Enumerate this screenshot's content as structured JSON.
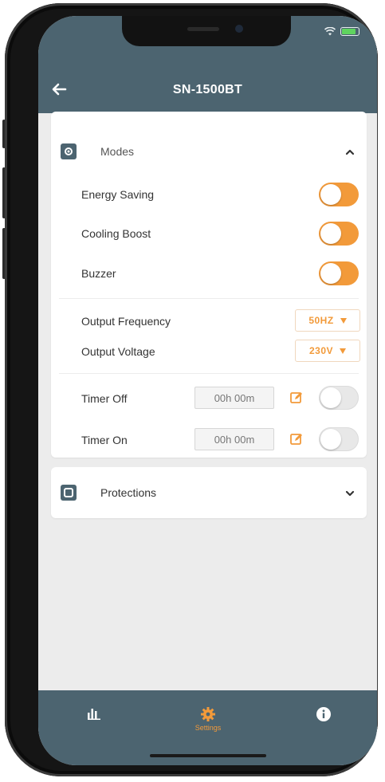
{
  "header": {
    "title": "SN-1500BT"
  },
  "colors": {
    "header": "#4c6470",
    "accent": "#f29a3a",
    "background": "#ececec"
  },
  "modes": {
    "section_label": "Modes",
    "expanded": true,
    "switches": [
      {
        "label": "Energy Saving",
        "on": true
      },
      {
        "label": "Cooling Boost",
        "on": true
      },
      {
        "label": "Buzzer",
        "on": true
      }
    ],
    "output": [
      {
        "label": "Output Frequency",
        "value": "50HZ"
      },
      {
        "label": "Output Voltage",
        "value": "230V"
      }
    ],
    "timers": [
      {
        "label": "Timer Off",
        "value": "00h 00m",
        "enabled": false
      },
      {
        "label": "Timer On",
        "value": "00h 00m",
        "enabled": false
      }
    ]
  },
  "protections": {
    "section_label": "Protections",
    "expanded": false
  },
  "tabbar": {
    "items": [
      {
        "icon": "bar-chart-icon",
        "label": ""
      },
      {
        "icon": "gear-icon",
        "label": "Settings",
        "active": true
      },
      {
        "icon": "info-icon",
        "label": ""
      }
    ]
  }
}
